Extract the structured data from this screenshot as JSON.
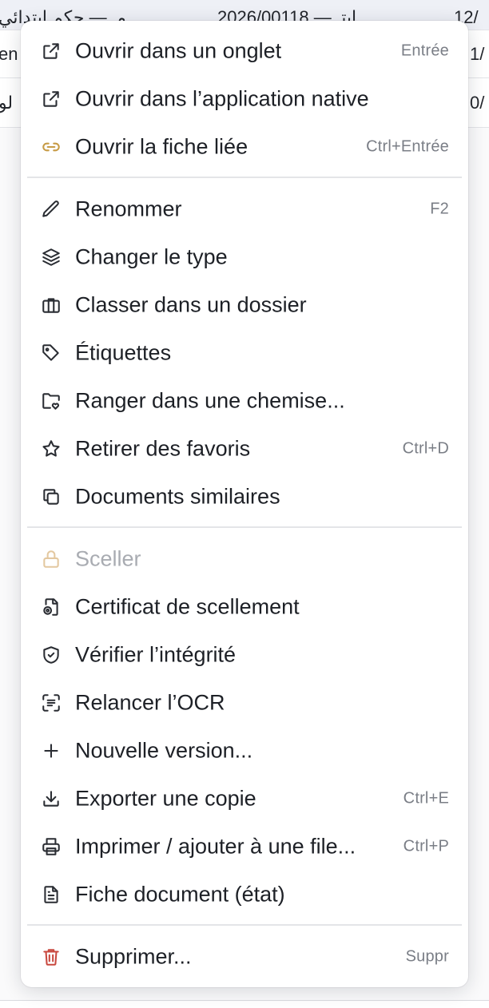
{
  "background": {
    "rows": [
      {
        "left": "مـ — حكم ابتدائي",
        "middle": "2026/00118 — ابتـ",
        "right": "12/"
      },
      {
        "left": "en",
        "middle": "",
        "right": "1/"
      },
      {
        "left": "لو",
        "middle": "",
        "right": "0/"
      }
    ]
  },
  "menu": {
    "groups": [
      [
        {
          "label": "Ouvrir dans un onglet",
          "shortcut": "Entrée",
          "icon": "external-link-icon"
        },
        {
          "label": "Ouvrir dans l’application native",
          "shortcut": "",
          "icon": "external-link-icon"
        },
        {
          "label": "Ouvrir la fiche liée",
          "shortcut": "Ctrl+Entrée",
          "icon": "link-icon"
        }
      ],
      [
        {
          "label": "Renommer",
          "shortcut": "F2",
          "icon": "pencil-icon"
        },
        {
          "label": "Changer le type",
          "shortcut": "",
          "icon": "layers-icon"
        },
        {
          "label": "Classer dans un dossier",
          "shortcut": "",
          "icon": "briefcase-icon"
        },
        {
          "label": "Étiquettes",
          "shortcut": "",
          "icon": "tag-icon"
        },
        {
          "label": "Ranger dans une chemise...",
          "shortcut": "",
          "icon": "folder-heart-icon"
        },
        {
          "label": "Retirer des favoris",
          "shortcut": "Ctrl+D",
          "icon": "star-icon"
        },
        {
          "label": "Documents similaires",
          "shortcut": "",
          "icon": "copy-icon"
        }
      ],
      [
        {
          "label": "Sceller",
          "shortcut": "",
          "icon": "lock-icon",
          "disabled": true
        },
        {
          "label": "Certificat de scellement",
          "shortcut": "",
          "icon": "file-badge-icon"
        },
        {
          "label": "Vérifier l’intégrité",
          "shortcut": "",
          "icon": "shield-check-icon"
        },
        {
          "label": "Relancer l’OCR",
          "shortcut": "",
          "icon": "scan-text-icon"
        },
        {
          "label": "Nouvelle version...",
          "shortcut": "",
          "icon": "plus-icon"
        },
        {
          "label": "Exporter une copie",
          "shortcut": "Ctrl+E",
          "icon": "download-icon"
        },
        {
          "label": "Imprimer / ajouter à une file...",
          "shortcut": "Ctrl+P",
          "icon": "printer-icon"
        },
        {
          "label": "Fiche document (état)",
          "shortcut": "",
          "icon": "file-text-icon"
        }
      ],
      [
        {
          "label": "Supprimer...",
          "shortcut": "Suppr",
          "icon": "trash-icon",
          "danger": true
        }
      ]
    ]
  },
  "colors": {
    "danger": "#c8483f",
    "link_accent": "#c79b45",
    "disabled_icon": "#e3c8a0"
  }
}
